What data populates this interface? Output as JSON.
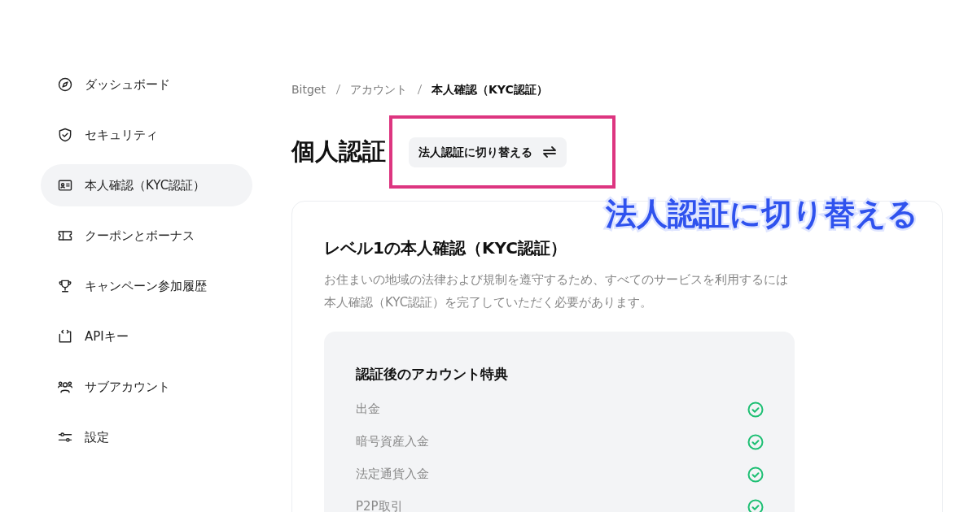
{
  "sidebar": {
    "items": [
      {
        "label": "ダッシュボード",
        "selected": false
      },
      {
        "label": "セキュリティ",
        "selected": false
      },
      {
        "label": "本人確認（KYC認証）",
        "selected": true
      },
      {
        "label": "クーポンとボーナス",
        "selected": false
      },
      {
        "label": "キャンペーン参加履歴",
        "selected": false
      },
      {
        "label": "APIキー",
        "selected": false
      },
      {
        "label": "サブアカウント",
        "selected": false
      },
      {
        "label": "設定",
        "selected": false
      }
    ]
  },
  "breadcrumb": [
    "Bitget",
    "アカウント",
    "本人確認（KYC認証）"
  ],
  "page_title": "個人認証",
  "switch_button": {
    "label": "法人認証に切り替える",
    "highlighted": true
  },
  "annotation": "法人認証に切り替える",
  "card": {
    "title": "レベル1の本人確認（KYC認証）",
    "description": "お住まいの地域の法律および規制を遵守するため、すべてのサービスを利用するには本人確認（KYC認証）を完了していただく必要があります。",
    "benefits": {
      "title": "認証後のアカウント特典",
      "items": [
        {
          "label": "出金",
          "available": true
        },
        {
          "label": "暗号資産入金",
          "available": true
        },
        {
          "label": "法定通貨入金",
          "available": true
        },
        {
          "label": "P2P取引",
          "available": true
        }
      ]
    }
  }
}
